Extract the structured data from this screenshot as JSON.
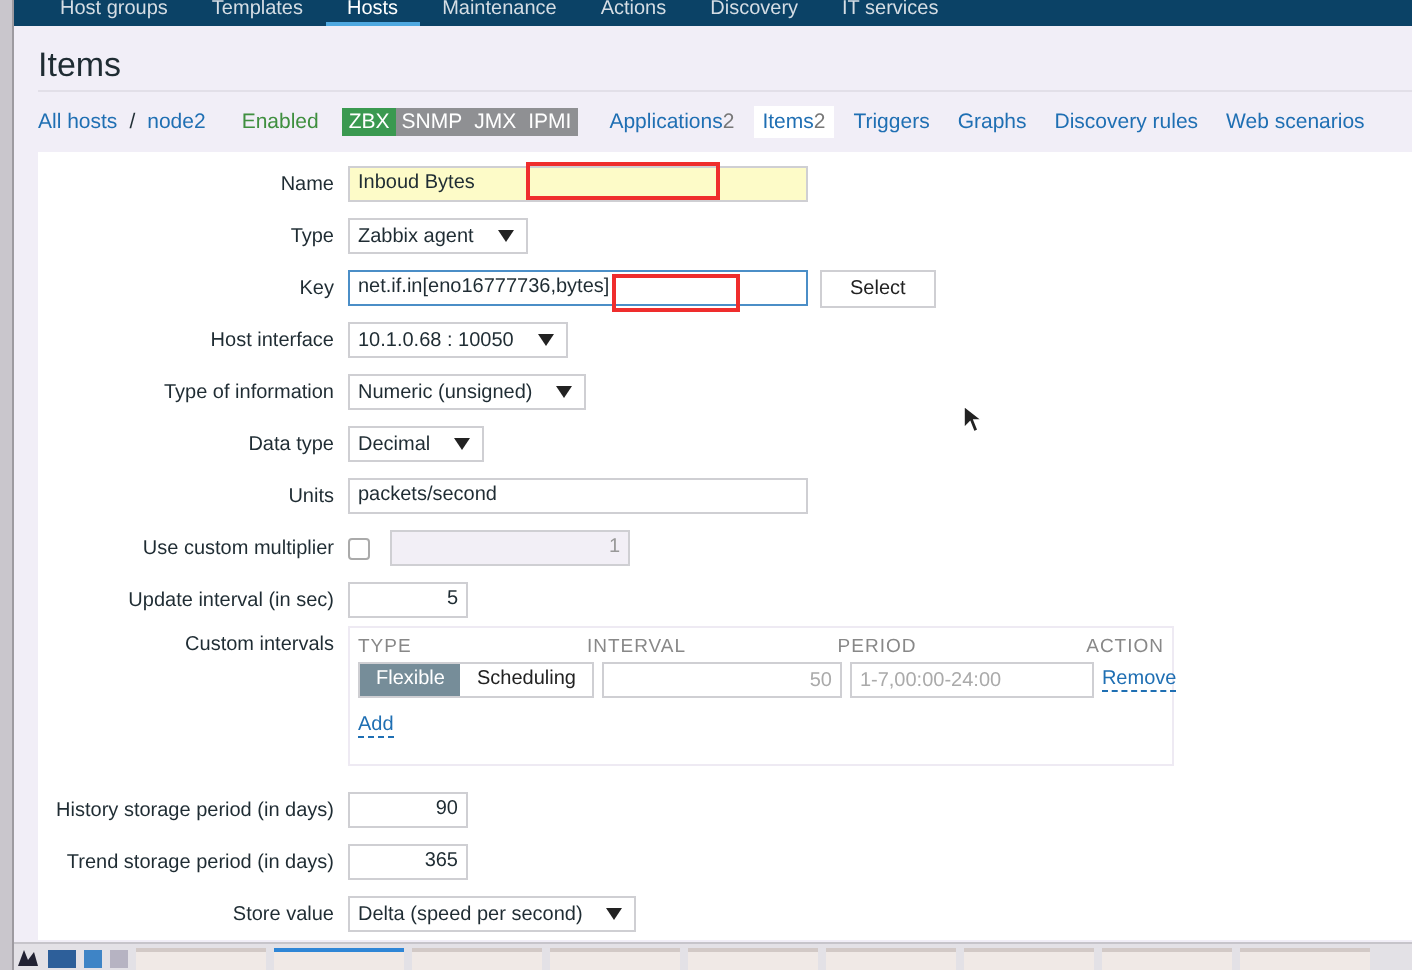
{
  "nav": [
    {
      "label": "Host groups",
      "selected": false
    },
    {
      "label": "Templates",
      "selected": false
    },
    {
      "label": "Hosts",
      "selected": true
    },
    {
      "label": "Maintenance",
      "selected": false
    },
    {
      "label": "Actions",
      "selected": false
    },
    {
      "label": "Discovery",
      "selected": false
    },
    {
      "label": "IT services",
      "selected": false
    }
  ],
  "title": "Items",
  "breadcrumb": [
    "All hosts",
    "node2"
  ],
  "breadcrumb_separator": "/",
  "host_status": "Enabled",
  "availability": [
    {
      "label": "ZBX",
      "available": true
    },
    {
      "label": "SNMP",
      "available": false
    },
    {
      "label": "JMX",
      "available": false
    },
    {
      "label": "IPMI",
      "available": false
    }
  ],
  "host_tabs": [
    {
      "label": "Applications",
      "count": "2",
      "selected": false
    },
    {
      "label": "Items",
      "count": "2",
      "selected": true
    },
    {
      "label": "Triggers",
      "selected": false
    },
    {
      "label": "Graphs",
      "selected": false
    },
    {
      "label": "Discovery rules",
      "selected": false
    },
    {
      "label": "Web scenarios",
      "selected": false
    }
  ],
  "fields": [
    {
      "kind": "text",
      "label": "Name",
      "value": "Inboud Bytes",
      "highlighted": true
    },
    {
      "kind": "select",
      "label": "Type",
      "value": "Zabbix agent"
    },
    {
      "kind": "key",
      "label": "Key",
      "value": "net.if.in[eno16777736,bytes]",
      "focused": true,
      "button": "Select"
    },
    {
      "kind": "select",
      "label": "Host interface",
      "value": "10.1.0.68 : 10050"
    },
    {
      "kind": "select",
      "label": "Type of information",
      "value": "Numeric (unsigned)"
    },
    {
      "kind": "select",
      "label": "Data type",
      "value": "Decimal"
    },
    {
      "kind": "text",
      "label": "Units",
      "value": "packets/second",
      "highlighted": false
    },
    {
      "kind": "multiplier",
      "label": "Use custom multiplier",
      "checked": false,
      "value": "1"
    },
    {
      "kind": "number",
      "label": "Update interval (in sec)",
      "value": "5"
    },
    {
      "kind": "intervals",
      "label": "Custom intervals",
      "columns": [
        "TYPE",
        "INTERVAL",
        "PERIOD",
        "ACTION"
      ],
      "types": [
        {
          "label": "Flexible",
          "selected": true
        },
        {
          "label": "Scheduling",
          "selected": false
        }
      ],
      "interval_placeholder": "50",
      "period_placeholder": "1-7,00:00-24:00",
      "action": "Remove",
      "add": "Add"
    },
    {
      "kind": "number",
      "label": "History storage period (in days)",
      "value": "90"
    },
    {
      "kind": "number",
      "label": "Trend storage period (in days)",
      "value": "365"
    },
    {
      "kind": "select",
      "label": "Store value",
      "value": "Delta (speed per second)"
    }
  ]
}
